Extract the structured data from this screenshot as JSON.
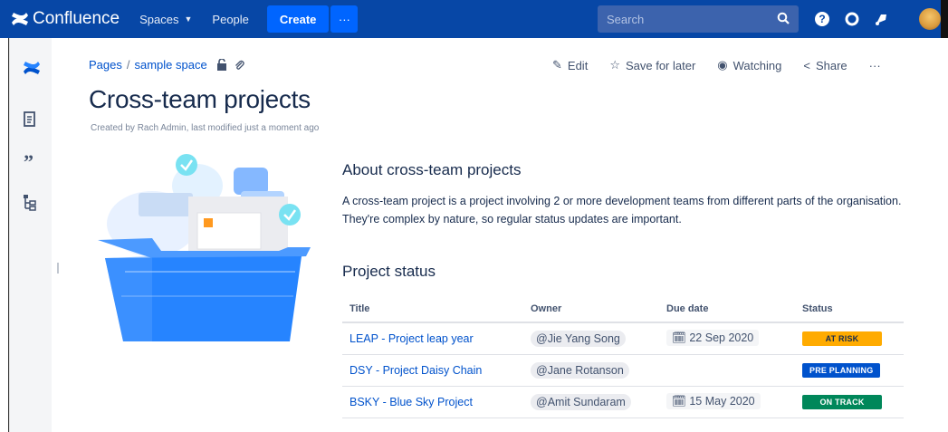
{
  "topnav": {
    "app_name": "Confluence",
    "spaces_label": "Spaces",
    "people_label": "People",
    "create_label": "Create",
    "more_label": "···",
    "search_placeholder": "Search"
  },
  "breadcrumb": {
    "pages": "Pages",
    "separator": "/",
    "space": "sample space"
  },
  "actions": {
    "edit": "Edit",
    "save_for_later": "Save for later",
    "watching": "Watching",
    "share": "Share",
    "more": "···"
  },
  "page": {
    "title": "Cross-team projects",
    "byline": "Created by Rach Admin, last modified just a moment ago"
  },
  "about": {
    "heading": "About cross-team projects",
    "text": "A cross-team project is a project involving 2 or more development teams from different parts of the organisation. They're complex by nature, so regular status updates are important."
  },
  "project_status": {
    "heading": "Project status",
    "columns": [
      "Title",
      "Owner",
      "Due date",
      "Status"
    ],
    "rows": [
      {
        "title": "LEAP - Project leap year",
        "owner": "@Jie Yang Song",
        "due": "22 Sep 2020",
        "status": "AT RISK"
      },
      {
        "title": "DSY - Project Daisy Chain",
        "owner": "@Jane Rotanson",
        "due": "",
        "status": "PRE PLANNING"
      },
      {
        "title": "BSKY - Blue Sky Project",
        "owner": "@Amit Sundaram",
        "due": "15 May 2020",
        "status": "ON TRACK"
      }
    ]
  },
  "colors": {
    "nav": "#0747a6",
    "accent": "#0065ff",
    "link": "#0052cc",
    "at_risk": "#ffab00",
    "pre_planning": "#0052cc",
    "on_track": "#00875a"
  },
  "icons": {
    "sidebar": [
      "confluence-logo-icon",
      "pages-icon",
      "quote-icon",
      "tree-icon"
    ],
    "topnav": [
      "search-icon",
      "help-icon",
      "settings-icon",
      "notifications-icon",
      "avatar"
    ]
  }
}
